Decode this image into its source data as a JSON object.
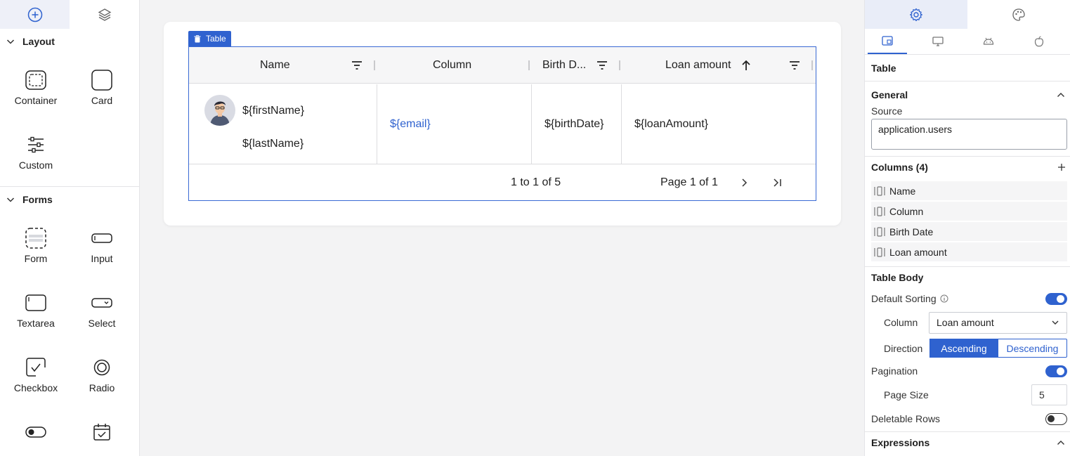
{
  "left_panel": {
    "sections": [
      {
        "title": "Layout",
        "items": [
          "Container",
          "Card",
          "Custom"
        ]
      },
      {
        "title": "Forms",
        "items": [
          "Form",
          "Input",
          "Textarea",
          "Select",
          "Checkbox",
          "Radio"
        ]
      }
    ]
  },
  "table_tag": "Table",
  "table": {
    "headers": [
      "Name",
      "Column",
      "Birth D...",
      "Loan amount"
    ],
    "row": {
      "first_name": "${firstName}",
      "last_name": "${lastName}",
      "email": "${email}",
      "birth_date": "${birthDate}",
      "loan_amount": "${loanAmount}"
    },
    "footer": {
      "range": "1 to 1 of 5",
      "page": "Page 1 of 1"
    }
  },
  "right_panel": {
    "title": "Table",
    "general": {
      "heading": "General",
      "source_label": "Source",
      "source_value": "application.users"
    },
    "columns": {
      "heading": "Columns (4)",
      "items": [
        "Name",
        "Column",
        "Birth Date",
        "Loan amount"
      ]
    },
    "table_body": {
      "heading": "Table Body",
      "default_sorting_label": "Default Sorting",
      "default_sorting_on": true,
      "column_label": "Column",
      "column_value": "Loan amount",
      "direction_label": "Direction",
      "direction_options": [
        "Ascending",
        "Descending"
      ],
      "direction_selected": "Ascending",
      "pagination_label": "Pagination",
      "pagination_on": true,
      "page_size_label": "Page Size",
      "page_size_value": "5",
      "deletable_rows_label": "Deletable Rows",
      "deletable_rows_on": false
    },
    "expressions_heading": "Expressions"
  },
  "colors": {
    "accent": "#2f62cf",
    "canvas_bg": "#f3f3f4"
  }
}
